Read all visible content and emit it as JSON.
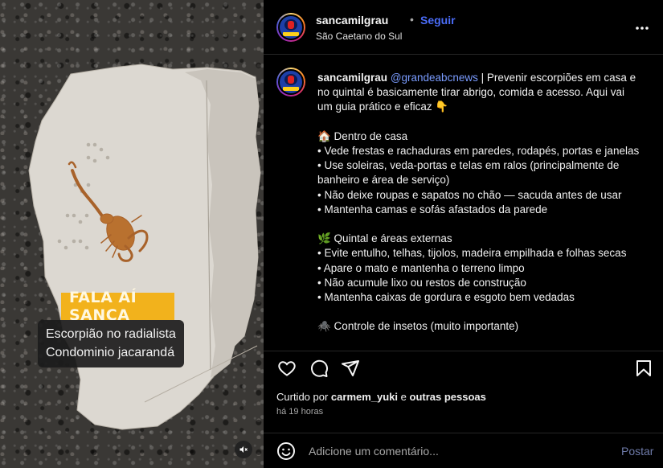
{
  "media": {
    "banner_text": "FALA AÍ SANCA",
    "caption_lines": [
      "Escorpião no radialista",
      "Condominio jacarandá"
    ],
    "mute_icon": "speaker-muted-icon"
  },
  "header": {
    "username": "sancamilgrau",
    "dot": "•",
    "follow_label": "Seguir",
    "location": "São Caetano do Sul",
    "more_icon": "more-horizontal-icon"
  },
  "caption": {
    "username": "sancamilgrau",
    "mention": "@grandeabcnews",
    "line1_rest": " | Prevenir escorpiões em casa e",
    "lines": [
      "no quintal é basicamente tirar abrigo, comida e acesso. Aqui vai",
      "um guia prático e eficaz 👇",
      "",
      "🏠 Dentro de casa",
      "• Vede frestas e rachaduras em paredes, rodapés, portas e janelas",
      "• Use soleiras, veda-portas e telas em ralos (principalmente de",
      "banheiro e área de serviço)",
      "• Não deixe roupas e sapatos no chão — sacuda antes de usar",
      "• Mantenha camas e sofás afastados da parede",
      "",
      "🌿 Quintal e áreas externas",
      "• Evite entulho, telhas, tijolos, madeira empilhada e folhas secas",
      "• Apare o mato e mantenha o terreno limpo",
      "• Não acumule lixo ou restos de construção",
      "• Mantenha caixas de gordura e esgoto bem vedadas",
      "",
      "🕷️ Controle de insetos (muito importante)"
    ]
  },
  "actions": {
    "like_icon": "heart-icon",
    "comment_icon": "comment-icon",
    "share_icon": "share-icon",
    "save_icon": "bookmark-icon"
  },
  "likes": {
    "prefix": "Curtido por ",
    "user": "carmem_yuki",
    "middle": " e ",
    "others": "outras pessoas"
  },
  "time": "há 19 horas",
  "comment_box": {
    "placeholder": "Adicione um comentário...",
    "post_label": "Postar",
    "emoji_icon": "emoji-icon"
  }
}
